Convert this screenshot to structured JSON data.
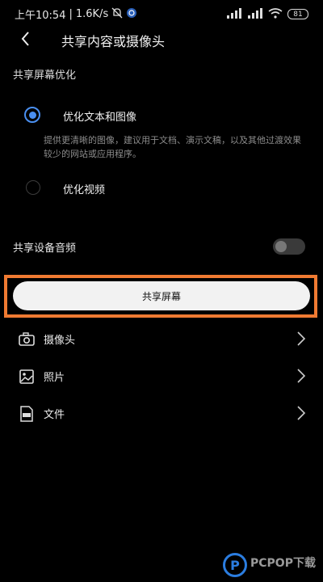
{
  "status_bar": {
    "time": "上午10:54",
    "speed": "1.6K/s",
    "battery": "81"
  },
  "header": {
    "back_icon": "chevron-left-icon",
    "title": "共享内容或摄像头"
  },
  "screen_section": {
    "label": "共享屏幕优化",
    "options": [
      {
        "label": "优化文本和图像",
        "selected": true,
        "description": "提供更清晰的图像，建议用于文档、演示文稿，以及其他过渡效果较少的网站或应用程序。"
      },
      {
        "label": "优化视频",
        "selected": false
      }
    ]
  },
  "audio": {
    "label": "共享设备音频",
    "enabled": false
  },
  "share_button": {
    "label": "共享屏幕",
    "highlight_color": "#f07a32"
  },
  "list": {
    "items": [
      {
        "label": "摄像头",
        "icon": "camera-icon"
      },
      {
        "label": "照片",
        "icon": "photo-icon"
      },
      {
        "label": "文件",
        "icon": "pdf-file-icon"
      }
    ]
  },
  "watermark": {
    "logo_letter": "P",
    "text": "PCPOP下载"
  },
  "colors": {
    "background": "#000000",
    "accent": "#4a8ff0"
  }
}
